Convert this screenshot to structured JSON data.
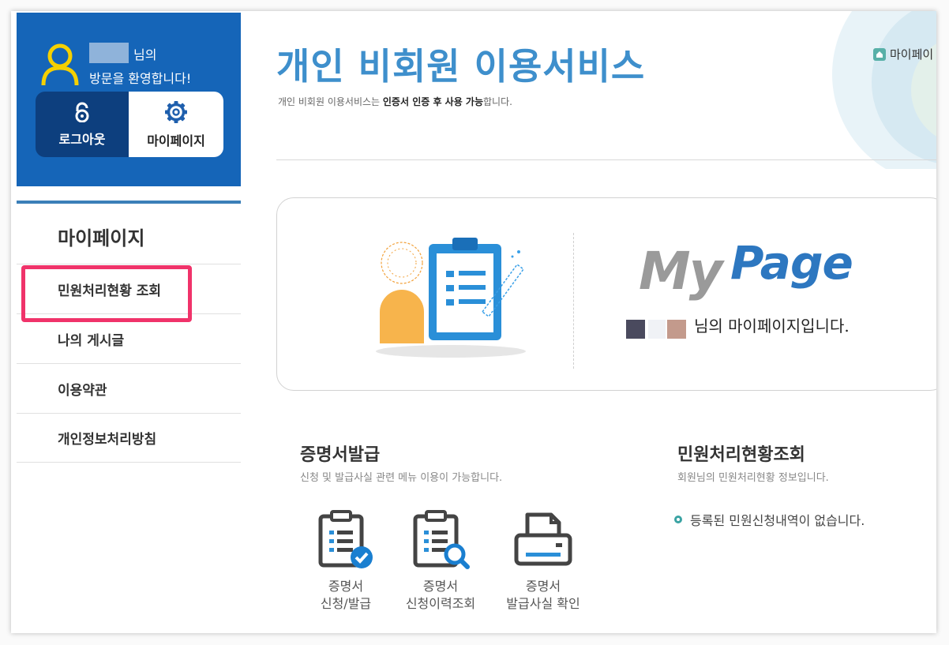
{
  "sidebar": {
    "user_suffix": "님의",
    "welcome": "방문을 환영합니다!",
    "logout_label": "로그아웃",
    "mypage_label": "마이페이지",
    "section_title": "마이페이지",
    "menu": [
      {
        "label": "민원처리현황 조회"
      },
      {
        "label": "나의 게시글"
      },
      {
        "label": "이용약관"
      },
      {
        "label": "개인정보처리방침"
      }
    ]
  },
  "header": {
    "title": "개인 비회원 이용서비스",
    "subtitle_pre": "개인 비회원 이용서비스는 ",
    "subtitle_bold": "인증서 인증 후 사용 가능",
    "subtitle_post": "합니다.",
    "breadcrumb": "마이페이"
  },
  "mypage_box": {
    "logo_my": "My",
    "logo_page": "Page",
    "message": "님의 마이페이지입니다."
  },
  "cert": {
    "title": "증명서발급",
    "subtitle": "신청 및 발급사실 관련 메뉴 이용이 가능합니다.",
    "items": [
      {
        "line1": "증명서",
        "line2": "신청/발급"
      },
      {
        "line1": "증명서",
        "line2": "신청이력조회"
      },
      {
        "line1": "증명서",
        "line2": "발급사실 확인"
      }
    ]
  },
  "complaint": {
    "title": "민원처리현황조회",
    "subtitle": "회원님의 민원처리현황 정보입니다.",
    "empty_message": "등록된 민원신청내역이 없습니다."
  },
  "colors": {
    "primary_blue": "#1565b8",
    "dark_blue": "#0d3f7e",
    "title_blue": "#3e8fcc",
    "highlight": "#f0336a"
  }
}
